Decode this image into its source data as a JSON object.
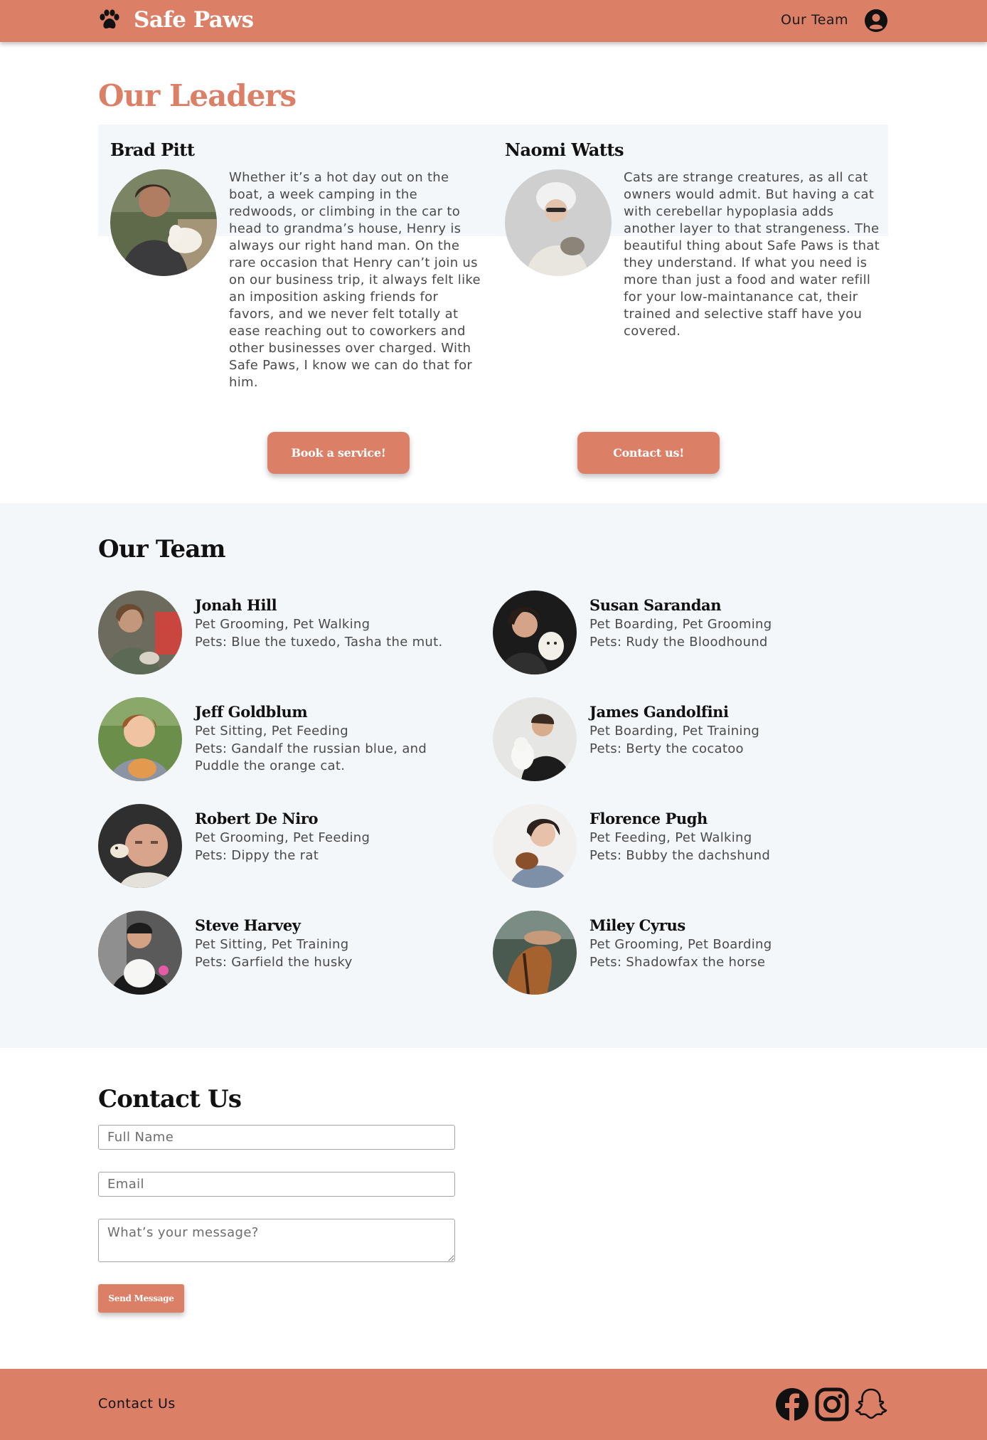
{
  "header": {
    "brand": "Safe Paws",
    "nav_team": "Our Team"
  },
  "leaders": {
    "title": "Our Leaders",
    "items": [
      {
        "name": "Brad Pitt",
        "text": "Whether it’s a hot day out on the boat, a week camping in the redwoods, or climbing in the car to head to grandma’s house, Henry is always our right hand man. On the rare occasion that Henry can’t join us on our business trip, it always felt like an imposition asking friends for favors, and we never felt totally at ease reaching out to coworkers and other businesses over charged. With Safe Paws, I know we can do that for him."
      },
      {
        "name": "Naomi Watts",
        "text": "Cats are strange creatures, as all cat owners would admit. But having a cat with cerebellar hypoplasia adds another layer to that strangeness. The beautiful thing about Safe Paws is that they understand. If what you need is more than just a food and water refill for your low-maintanance cat, their trained and selective staff have you covered."
      }
    ],
    "book_button": "Book a service!",
    "contact_button": "Contact us!"
  },
  "team": {
    "title": "Our Team",
    "members": [
      {
        "name": "Jonah Hill",
        "services": "Pet Grooming, Pet Walking",
        "pets": "Pets: Blue the tuxedo, Tasha the mut."
      },
      {
        "name": "Susan Sarandan",
        "services": "Pet Boarding, Pet Grooming",
        "pets": "Pets: Rudy the Bloodhound"
      },
      {
        "name": "Jeff Goldblum",
        "services": "Pet Sitting, Pet Feeding",
        "pets": "Pets: Gandalf the russian blue, and Puddle the orange cat."
      },
      {
        "name": "James Gandolfini",
        "services": "Pet Boarding, Pet Training",
        "pets": "Pets: Berty the cocatoo"
      },
      {
        "name": "Robert De Niro",
        "services": "Pet Grooming, Pet Feeding",
        "pets": "Pets: Dippy the rat"
      },
      {
        "name": "Florence Pugh",
        "services": "Pet Feeding, Pet Walking",
        "pets": "Pets: Bubby the dachshund"
      },
      {
        "name": "Steve Harvey",
        "services": "Pet Sitting, Pet Training",
        "pets": "Pets: Garfield the husky"
      },
      {
        "name": "Miley Cyrus",
        "services": "Pet Grooming, Pet Boarding",
        "pets": "Pets: Shadowfax the horse"
      }
    ]
  },
  "contact": {
    "title": "Contact Us",
    "name_placeholder": "Full Name",
    "email_placeholder": "Email",
    "message_placeholder": "What’s your message?",
    "send_button": "Send Message"
  },
  "footer": {
    "contact_link": "Contact Us",
    "icons": [
      "facebook-icon",
      "instagram-icon",
      "snapchat-icon"
    ]
  },
  "colors": {
    "brand": "#dc7f67",
    "light_bg": "#f4f7fa"
  }
}
